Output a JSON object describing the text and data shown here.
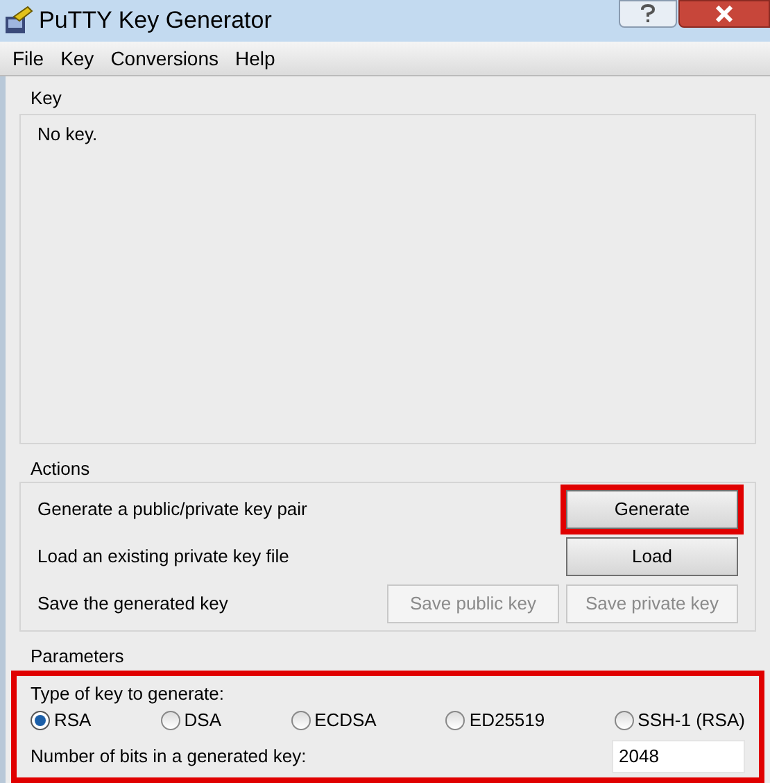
{
  "window": {
    "title": "PuTTY Key Generator"
  },
  "menu": [
    "File",
    "Key",
    "Conversions",
    "Help"
  ],
  "key": {
    "title": "Key",
    "text": "No key."
  },
  "actions": {
    "title": "Actions",
    "rows": [
      {
        "label": "Generate a public/private key pair",
        "buttons": [
          {
            "label": "Generate",
            "disabled": false,
            "highlighted": true
          }
        ]
      },
      {
        "label": "Load an existing private key file",
        "buttons": [
          {
            "label": "Load",
            "disabled": false,
            "highlighted": false
          }
        ]
      },
      {
        "label": "Save the generated key",
        "buttons": [
          {
            "label": "Save public key",
            "disabled": true,
            "highlighted": false
          },
          {
            "label": "Save private key",
            "disabled": true,
            "highlighted": false
          }
        ]
      }
    ]
  },
  "parameters": {
    "title": "Parameters",
    "highlighted": true,
    "type_label": "Type of key to generate:",
    "types": [
      {
        "label": "RSA",
        "selected": true
      },
      {
        "label": "DSA",
        "selected": false
      },
      {
        "label": "ECDSA",
        "selected": false
      },
      {
        "label": "ED25519",
        "selected": false
      },
      {
        "label": "SSH-1 (RSA)",
        "selected": false
      }
    ],
    "bits_label": "Number of bits in a generated key:",
    "bits": "2048"
  }
}
